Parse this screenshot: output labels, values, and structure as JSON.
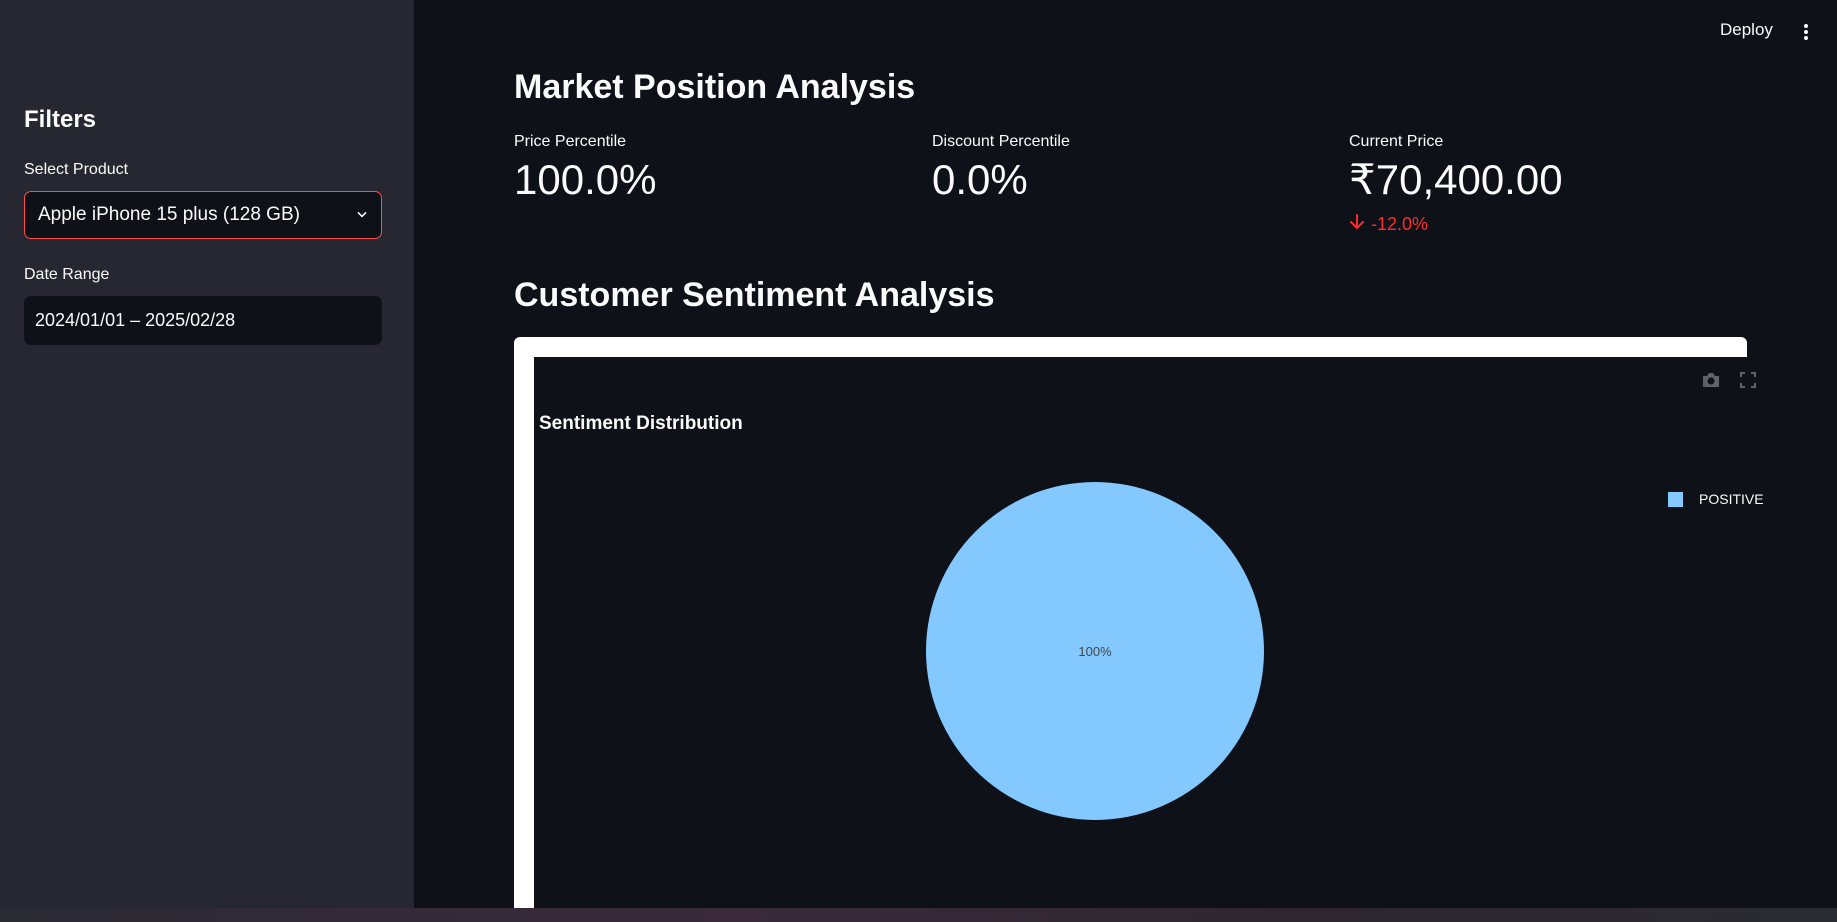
{
  "header": {
    "deploy_label": "Deploy",
    "menu_icon": "kebab-menu-icon"
  },
  "sidebar": {
    "title": "Filters",
    "product": {
      "label": "Select Product",
      "value": "Apple iPhone 15 plus (128 GB)"
    },
    "date_range": {
      "label": "Date Range",
      "value": "2024/01/01 – 2025/02/28"
    }
  },
  "main": {
    "market_title": "Market Position Analysis",
    "metrics": [
      {
        "label": "Price Percentile",
        "value": "100.0%"
      },
      {
        "label": "Discount Percentile",
        "value": "0.0%"
      },
      {
        "label": "Current Price",
        "value": "₹70,400.00",
        "delta": "-12.0%"
      }
    ],
    "sentiment_title": "Customer Sentiment Analysis"
  },
  "colors": {
    "accent": "#ff4b4b",
    "delta_negative": "#ff2b2b",
    "positive_slice": "#83c9ff",
    "background": "#0e1117",
    "sidebar": "#262730"
  },
  "chart_data": {
    "type": "pie",
    "title": "Sentiment Distribution",
    "categories": [
      "POSITIVE"
    ],
    "values": [
      100
    ],
    "data_labels": [
      "100%"
    ],
    "legend": "top-right"
  }
}
